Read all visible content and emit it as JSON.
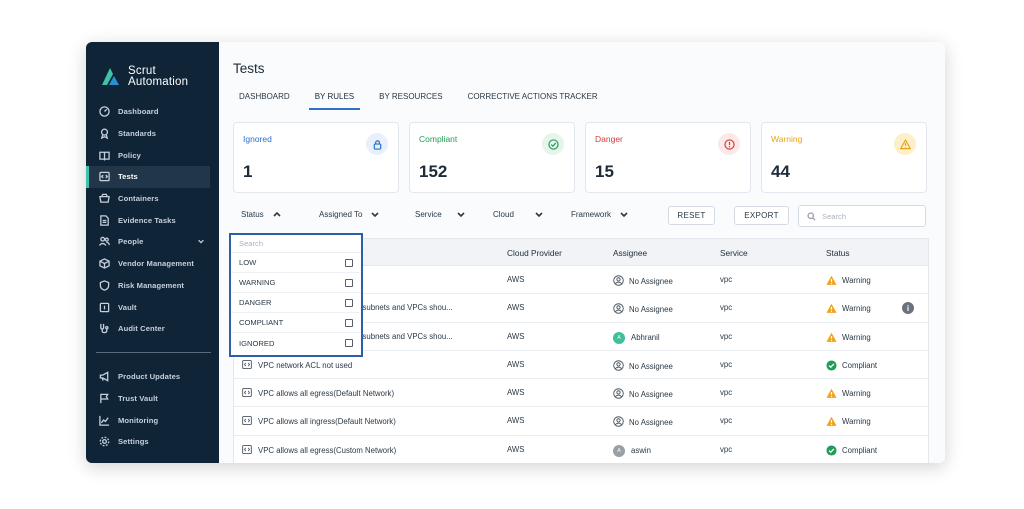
{
  "brand": {
    "line1": "Scrut",
    "line2": "Automation"
  },
  "sidebar": {
    "items": [
      {
        "label": "Dashboard",
        "icon": "dashboard-icon"
      },
      {
        "label": "Standards",
        "icon": "award-icon"
      },
      {
        "label": "Policy",
        "icon": "book-icon"
      },
      {
        "label": "Tests",
        "icon": "code-icon",
        "active": true
      },
      {
        "label": "Containers",
        "icon": "box-icon"
      },
      {
        "label": "Evidence Tasks",
        "icon": "file-icon"
      },
      {
        "label": "People",
        "icon": "people-icon",
        "expandable": true
      },
      {
        "label": "Vendor Management",
        "icon": "cube-icon"
      },
      {
        "label": "Risk Management",
        "icon": "shield-icon"
      },
      {
        "label": "Vault",
        "icon": "vault-icon"
      },
      {
        "label": "Audit Center",
        "icon": "stethoscope-icon"
      }
    ],
    "bottom_items": [
      {
        "label": "Product Updates",
        "icon": "megaphone-icon"
      },
      {
        "label": "Trust Vault",
        "icon": "flag-icon"
      },
      {
        "label": "Monitoring",
        "icon": "chart-icon"
      },
      {
        "label": "Settings",
        "icon": "gear-icon"
      }
    ]
  },
  "page": {
    "title": "Tests"
  },
  "tabs": [
    {
      "label": "DASHBOARD"
    },
    {
      "label": "BY RULES",
      "active": true
    },
    {
      "label": "BY RESOURCES"
    },
    {
      "label": "CORRECTIVE ACTIONS TRACKER"
    }
  ],
  "cards": [
    {
      "label": "Ignored",
      "value": "1",
      "color": "#2e6fc8",
      "icon": "lock-icon",
      "icon_bg": "#e8f0fb"
    },
    {
      "label": "Compliant",
      "value": "152",
      "color": "#1f9d57",
      "icon": "check-circle-icon",
      "icon_bg": "#e6f5ec"
    },
    {
      "label": "Danger",
      "value": "15",
      "color": "#d93b3b",
      "icon": "alert-circle-icon",
      "icon_bg": "#fbe9e9"
    },
    {
      "label": "Warning",
      "value": "44",
      "color": "#e8a21b",
      "icon": "warning-triangle-icon",
      "icon_bg": "#fdefc9"
    }
  ],
  "filters": {
    "status": "Status",
    "assigned_to": "Assigned To",
    "service": "Service",
    "cloud": "Cloud",
    "framework": "Framework",
    "reset": "RESET",
    "export": "EXPORT",
    "search_placeholder": "Search"
  },
  "table": {
    "headers": {
      "cloud": "Cloud Provider",
      "assignee": "Assignee",
      "service": "Service",
      "status": "Status"
    },
    "rows": [
      {
        "rule": "",
        "cloud": "AWS",
        "assignee": "No Assignee",
        "avatar": null,
        "service": "vpc",
        "status": "Warning"
      },
      {
        "rule": "h subnets and VPCs shou...",
        "cloud": "AWS",
        "assignee": "No Assignee",
        "avatar": null,
        "service": "vpc",
        "status": "Warning",
        "info": true
      },
      {
        "rule": "h subnets and VPCs shou...",
        "cloud": "AWS",
        "assignee": "Abhranil",
        "avatar": "A",
        "avatar_color": "#3fbf9a",
        "service": "vpc",
        "status": "Warning"
      },
      {
        "rule": "VPC network ACL not used",
        "cloud": "AWS",
        "assignee": "No Assignee",
        "avatar": null,
        "service": "vpc",
        "status": "Compliant"
      },
      {
        "rule": "VPC allows all egress(Default Network)",
        "cloud": "AWS",
        "assignee": "No Assignee",
        "avatar": null,
        "service": "vpc",
        "status": "Warning"
      },
      {
        "rule": "VPC allows all ingress(Default Network)",
        "cloud": "AWS",
        "assignee": "No Assignee",
        "avatar": null,
        "service": "vpc",
        "status": "Warning"
      },
      {
        "rule": "VPC allows all egress(Custom Network)",
        "cloud": "AWS",
        "assignee": "aswin",
        "avatar": "A",
        "avatar_color": "#9aa0a6",
        "service": "vpc",
        "status": "Compliant"
      }
    ]
  },
  "status_dropdown": {
    "search_placeholder": "Search",
    "options": [
      "LOW",
      "WARNING",
      "DANGER",
      "COMPLIANT",
      "IGNORED"
    ]
  }
}
